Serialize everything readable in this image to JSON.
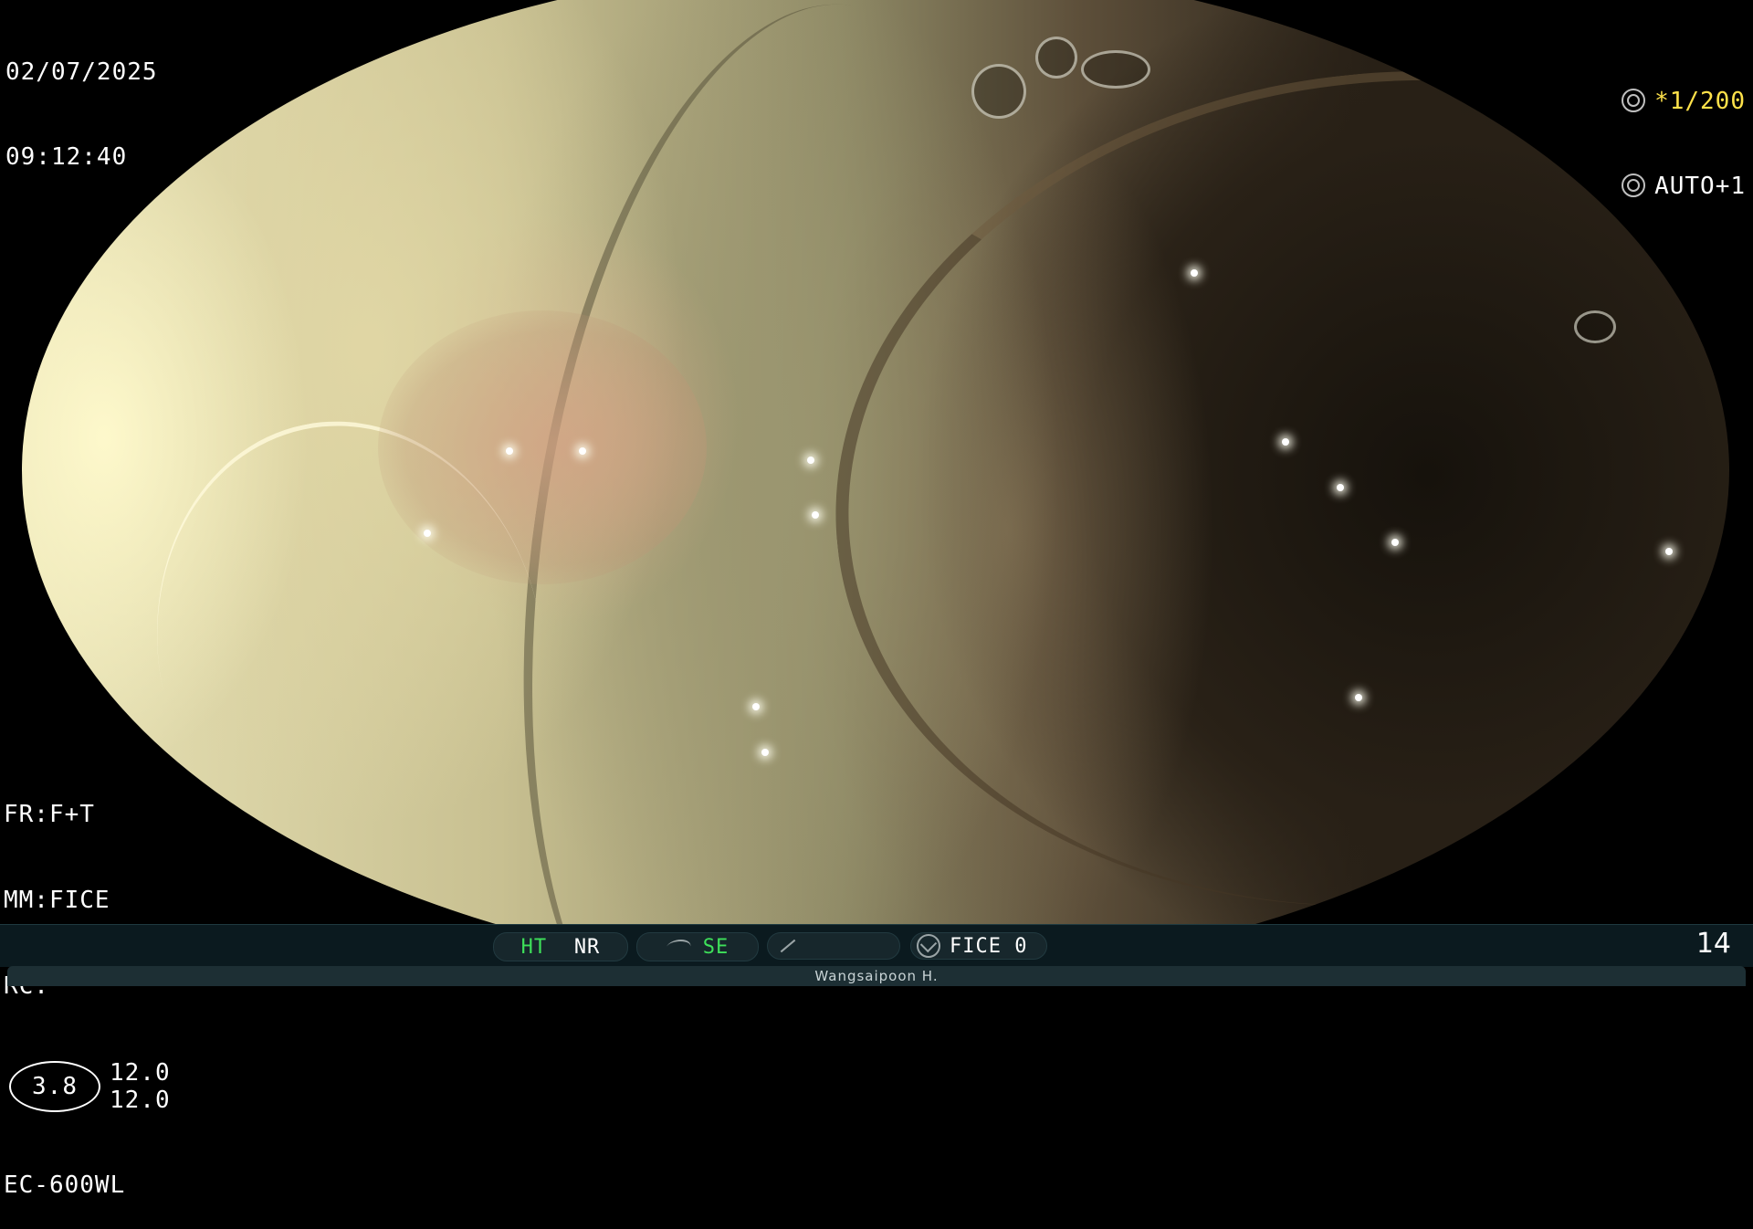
{
  "osd": {
    "date": "02/07/2025",
    "time": "09:12:40",
    "shutter_prefix": "*",
    "shutter_value": "1/200",
    "exposure": "AUTO+1",
    "fr": "FR:F+T",
    "mm": "MM:FICE",
    "rc": "RC:",
    "ratio_main": "3.8",
    "ratio_top": "12.0",
    "ratio_bottom": "12.0",
    "scope_model": "EC-600WL"
  },
  "status_bar": {
    "ht": "HT",
    "nr": "NR",
    "se": "SE",
    "fice": "FICE 0",
    "frame_count": "14",
    "operator": "Wangsaipoon H."
  },
  "colors": {
    "accent_green": "#3ee05a",
    "accent_yellow": "#ffe24a",
    "bar_bg": "#0b1a1f"
  },
  "icons": {
    "shutter": "shutter-icon",
    "exposure": "iris-icon",
    "structure": "wave-icon",
    "color": "slash-icon",
    "fice": "fice-icon"
  }
}
